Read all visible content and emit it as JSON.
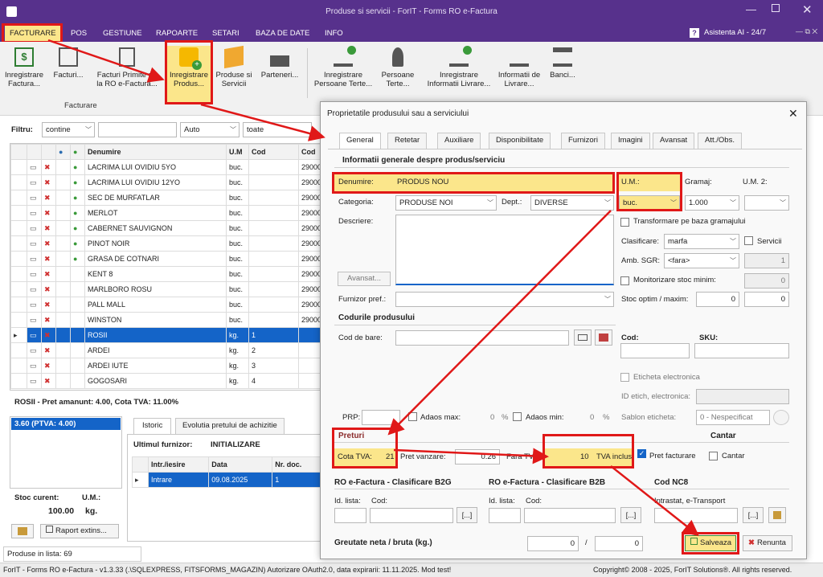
{
  "window": {
    "title": "Produse si servicii - ForIT - Forms RO e-Factura"
  },
  "menu": [
    "FACTURARE",
    "POS",
    "GESTIUNE",
    "RAPOARTE",
    "SETARI",
    "BAZA DE DATE",
    "INFO"
  ],
  "assistant": "Asistenta AI - 24/7",
  "ribbon": {
    "buttons": [
      {
        "l1": "Inregistrare",
        "l2": "Factura..."
      },
      {
        "l1": "Facturi...",
        "l2": ""
      },
      {
        "l1": "Facturi Primite de",
        "l2": "la RO e-Factura..."
      },
      {
        "l1": "Inregistrare",
        "l2": "Produs..."
      },
      {
        "l1": "Produse si",
        "l2": "Servicii"
      },
      {
        "l1": "Parteneri...",
        "l2": ""
      },
      {
        "l1": "Inregistrare",
        "l2": "Persoane Terte..."
      },
      {
        "l1": "Persoane",
        "l2": "Terte..."
      },
      {
        "l1": "Inregistrare",
        "l2": "Informatii Livrare..."
      },
      {
        "l1": "Informatii de",
        "l2": "Livrare..."
      },
      {
        "l1": "Banci...",
        "l2": ""
      }
    ],
    "group": "Facturare"
  },
  "filter": {
    "label": "Filtru:",
    "mode": "contine",
    "value": "",
    "auto": "Auto",
    "scope": "toate"
  },
  "grid": {
    "headers": {
      "name": "Denumire",
      "um": "U.M",
      "cod": "Cod",
      "cod2": "Cod"
    },
    "rows": [
      {
        "name": "LACRIMA LUI OVIDIU 5YO",
        "um": "buc.",
        "cod": "",
        "c2": "29000",
        "rec": true
      },
      {
        "name": "LACRIMA LUI OVIDIU 12YO",
        "um": "buc.",
        "cod": "",
        "c2": "29000",
        "rec": true
      },
      {
        "name": "SEC DE MURFATLAR",
        "um": "buc.",
        "cod": "",
        "c2": "29000",
        "rec": true
      },
      {
        "name": "MERLOT",
        "um": "buc.",
        "cod": "",
        "c2": "29000",
        "rec": true
      },
      {
        "name": "CABERNET SAUVIGNON",
        "um": "buc.",
        "cod": "",
        "c2": "29000",
        "rec": true
      },
      {
        "name": "PINOT NOIR",
        "um": "buc.",
        "cod": "",
        "c2": "29000",
        "rec": true
      },
      {
        "name": "GRASA DE COTNARI",
        "um": "buc.",
        "cod": "",
        "c2": "29000",
        "rec": true
      },
      {
        "name": "KENT 8",
        "um": "buc.",
        "cod": "",
        "c2": "29000",
        "rec": false
      },
      {
        "name": "MARLBORO ROSU",
        "um": "buc.",
        "cod": "",
        "c2": "29000",
        "rec": false
      },
      {
        "name": "PALL MALL",
        "um": "buc.",
        "cod": "",
        "c2": "29000",
        "rec": false
      },
      {
        "name": "WINSTON",
        "um": "buc.",
        "cod": "",
        "c2": "29000",
        "rec": false
      },
      {
        "name": "ROSII",
        "um": "kg.",
        "cod": "1",
        "c2": "",
        "rec": false
      },
      {
        "name": "ARDEI",
        "um": "kg.",
        "cod": "2",
        "c2": "",
        "rec": false
      },
      {
        "name": "ARDEI IUTE",
        "um": "kg.",
        "cod": "3",
        "c2": "",
        "rec": false
      },
      {
        "name": "GOGOSARI",
        "um": "kg.",
        "cod": "4",
        "c2": "",
        "rec": false
      }
    ]
  },
  "summary": "ROSII - Pret amanunt: 4.00, Cota TVA: 11.00%",
  "priceBox": "3.60 (PTVA: 4.00)",
  "stock": {
    "label": "Stoc curent:",
    "um_label": "U.M.:",
    "value": "100.00",
    "um": "kg."
  },
  "raport": "Raport extins...",
  "history": {
    "tabs": [
      "Istoric",
      "Evolutia pretului de achizitie"
    ],
    "supplier_label": "Ultimul furnizor:",
    "supplier": "INITIALIZARE",
    "cols": [
      "Intr./iesire",
      "Data",
      "Nr. doc."
    ],
    "row": [
      "Intrare",
      "09.08.2025",
      "1"
    ]
  },
  "count": "Produse in lista: 69",
  "status": {
    "left": "ForIT - Forms RO e-Factura - v1.3.33 (.\\SQLEXPRESS, FITSFORMS_MAGAZIN)  Autorizare OAuth2.0, data expirarii: 11.11.2025. Mod test!",
    "right": "Copyright© 2008 - 2025, ForIT Solutions®. All rights reserved."
  },
  "dialog": {
    "title": "Proprietatile produsului sau a serviciului",
    "tabs": [
      "General",
      "Retetar",
      "Auxiliare",
      "Disponibilitate",
      "Furnizori",
      "Imagini",
      "Avansat",
      "Att./Obs."
    ],
    "section1": "Informatii generale despre produs/serviciu",
    "denumire_label": "Denumire:",
    "denumire": "PRODUS NOU",
    "um_label": "U.M.:",
    "um": "buc.",
    "gramaj_label": "Gramaj:",
    "gramaj": "1.000",
    "um2_label": "U.M. 2:",
    "categoria_label": "Categoria:",
    "categoria": "PRODUSE NOI",
    "dept_label": "Dept.:",
    "dept": "DIVERSE",
    "descriere_label": "Descriere:",
    "avansat_btn": "Avansat...",
    "transformare": "Transformare pe baza gramajului",
    "clasificare_label": "Clasificare:",
    "clasificare": "marfa",
    "servicii": "Servicii",
    "sgr_label": "Amb. SGR:",
    "sgr": "<fara>",
    "sgr_val": "1",
    "monitor": "Monitorizare stoc minim:",
    "monitor_val": "0",
    "furnizor_label": "Furnizor pref.:",
    "stoc_label": "Stoc optim / maxim:",
    "stoc_opt": "0",
    "stoc_max": "0",
    "section2": "Codurile produsului",
    "codbare_label": "Cod de bare:",
    "cod_label": "Cod:",
    "sku_label": "SKU:",
    "eticheta": "Eticheta electronica",
    "idetich": "ID etich, electronica:",
    "prp_label": "PRP:",
    "adaos_max": "Adaos max:",
    "adaos_max_val": "0",
    "pct": "%",
    "adaos_min": "Adaos min:",
    "adaos_min_val": "0",
    "sablon_label": "Sablon eticheta:",
    "sablon": "0 - Nespecificat",
    "preturi": "Preturi",
    "cantar_h": "Cantar",
    "cota_label": "Cota TVA:",
    "cota": "21",
    "pret_label": "Pret vanzare:",
    "pret": "0.26",
    "fara_label": "Fara TVA",
    "fara": "10",
    "tva_inclus": "TVA inclus",
    "pret_fact": "Pret facturare",
    "cantar": "Cantar",
    "b2g": "RO e-Factura - Clasificare B2G",
    "b2b": "RO e-Factura - Clasificare B2B",
    "nc8": "Cod NC8",
    "idlista": "Id. lista:",
    "cod2": "Cod:",
    "intrastat": "Intrastat, e-Transport",
    "browse": "[...]",
    "greutate": "Greutate neta / bruta (kg.)",
    "gr1": "0",
    "gr_sep": "/",
    "gr2": "0",
    "save": "Salveaza",
    "cancel": "Renunta"
  }
}
